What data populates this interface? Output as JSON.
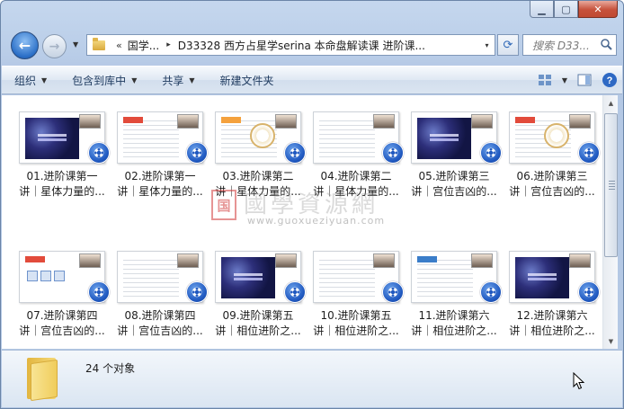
{
  "window": {
    "caption_buttons": [
      "minimize-icon",
      "maximize-icon",
      "close-icon"
    ]
  },
  "nav": {
    "back_icon": "arrow-left-icon",
    "forward_icon": "arrow-right-icon"
  },
  "address": {
    "chevrons": "«",
    "segment1": "国学...",
    "separator": "▸",
    "segment2": "D33328 西方占星学serina 本命盘解读课 进阶课...",
    "dropdown": "▾"
  },
  "search": {
    "placeholder": "搜索 D33..."
  },
  "toolbar": {
    "organize": "组织",
    "include_library": "包含到库中",
    "share": "共享",
    "new_folder": "新建文件夹"
  },
  "files": [
    {
      "line1": "01.进阶课第一",
      "line2": "讲｜星体力量的..."
    },
    {
      "line1": "02.进阶课第一",
      "line2": "讲｜星体力量的..."
    },
    {
      "line1": "03.进阶课第二",
      "line2": "讲｜星体力量的..."
    },
    {
      "line1": "04.进阶课第二",
      "line2": "讲｜星体力量的..."
    },
    {
      "line1": "05.进阶课第三",
      "line2": "讲｜宫位吉凶的..."
    },
    {
      "line1": "06.进阶课第三",
      "line2": "讲｜宫位吉凶的..."
    },
    {
      "line1": "07.进阶课第四",
      "line2": "讲｜宫位吉凶的..."
    },
    {
      "line1": "08.进阶课第四",
      "line2": "讲｜宫位吉凶的..."
    },
    {
      "line1": "09.进阶课第五",
      "line2": "讲｜相位进阶之..."
    },
    {
      "line1": "10.进阶课第五",
      "line2": "讲｜相位进阶之..."
    },
    {
      "line1": "11.进阶课第六",
      "line2": "讲｜相位进阶之..."
    },
    {
      "line1": "12.进阶课第六",
      "line2": "讲｜相位进阶之..."
    }
  ],
  "watermark": {
    "seal": "国",
    "text": "國學資源網",
    "url": "www.guoxueziyuan.com"
  },
  "status": {
    "count": "24 个对象"
  }
}
